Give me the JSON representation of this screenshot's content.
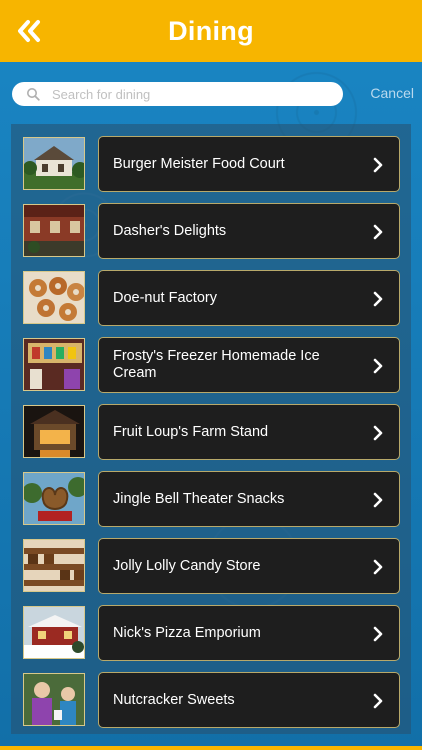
{
  "header": {
    "title": "Dining",
    "back_icon": "double-chevron-left-icon",
    "background_color": "#f7b500"
  },
  "search": {
    "placeholder": "Search for dining",
    "value": "",
    "cancel_label": "Cancel"
  },
  "items": [
    {
      "label": "Burger Meister Food Court",
      "thumb": "photo"
    },
    {
      "label": "Dasher's Delights",
      "thumb": "photo"
    },
    {
      "label": "Doe-nut Factory",
      "thumb": "photo"
    },
    {
      "label": "Frosty's Freezer Homemade Ice Cream",
      "thumb": "photo"
    },
    {
      "label": "Fruit Loup's Farm Stand",
      "thumb": "photo"
    },
    {
      "label": "Jingle Bell Theater Snacks",
      "thumb": "photo"
    },
    {
      "label": "Jolly Lolly Candy Store",
      "thumb": "photo"
    },
    {
      "label": "Nick's Pizza Emporium",
      "thumb": "photo"
    },
    {
      "label": "Nutcracker Sweets",
      "thumb": "photo"
    }
  ]
}
